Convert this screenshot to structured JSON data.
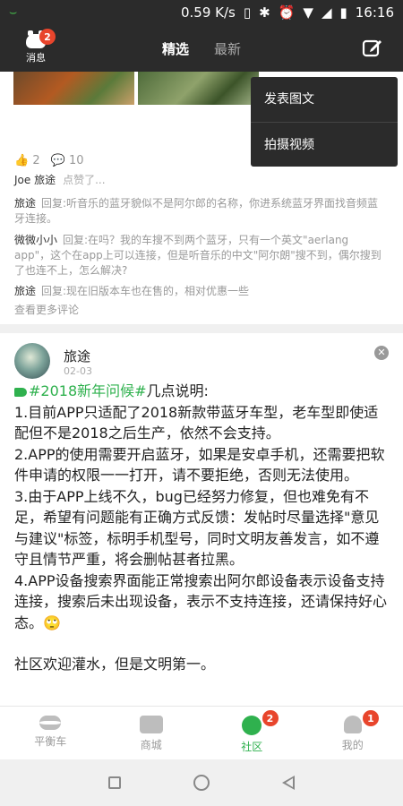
{
  "status_bar": {
    "speed": "0.59 K/s",
    "time": "16:16"
  },
  "top_bar": {
    "message_label": "消息",
    "message_badge": "2",
    "tab_active": "精选",
    "tab_inactive": "最新"
  },
  "popup_menu": {
    "items": [
      "发表图文",
      "拍摄视频"
    ]
  },
  "prev_post": {
    "like_count": "2",
    "comment_count": "10",
    "likers": "Joe 旅途",
    "liked_hint": "点赞了...",
    "comments": [
      {
        "author": "旅途",
        "text": "回复:听音乐的蓝牙貌似不是阿尔郎的名称，你进系统蓝牙界面找音频蓝牙连接。"
      },
      {
        "author": "微微小小",
        "text": "回复:在吗？我的车搜不到两个蓝牙，只有一个英文\"aerlang app\"，这个在app上可以连接，但是听音乐的中文\"阿尔朗\"搜不到，偶尔搜到了也连不上，怎么解决?"
      },
      {
        "author": "旅途",
        "text": "回复:现在旧版本车也在售的，相对优惠一些"
      }
    ],
    "more_comments": "查看更多评论"
  },
  "post": {
    "author": "旅途",
    "date": "02-03",
    "tag": "#2018新年问候#",
    "tag_suffix": "几点说明:",
    "lines": [
      "1.目前APP只适配了2018新款带蓝牙车型，老车型即使适配但不是2018之后生产，依然不会支持。",
      "2.APP的使用需要开启蓝牙，如果是安卓手机，还需要把软件申请的权限一一打开，请不要拒绝，否则无法使用。",
      "3.由于APP上线不久，bug已经努力修复，但也难免有不足，希望有问题能有正确方式反馈：发帖时尽量选择\"意见与建议\"标签，标明手机型号，同时文明友善发言，如不遵守且情节严重，将会删帖甚者拉黑。",
      "4.APP设备搜索界面能正常搜索出阿尔郎设备表示设备支持连接，搜索后未出现设备，表示不支持连接，还请保持好心态。🙄"
    ],
    "footer_line": "社区欢迎灌水，但是文明第一。"
  },
  "bottom_nav": {
    "items": [
      {
        "label": "平衡车",
        "badge": ""
      },
      {
        "label": "商城",
        "badge": ""
      },
      {
        "label": "社区",
        "badge": "2"
      },
      {
        "label": "我的",
        "badge": "1"
      }
    ]
  },
  "colors": {
    "accent_green": "#2fb14e",
    "badge_red": "#e8452c",
    "bar_dark": "#2b2b2b"
  }
}
